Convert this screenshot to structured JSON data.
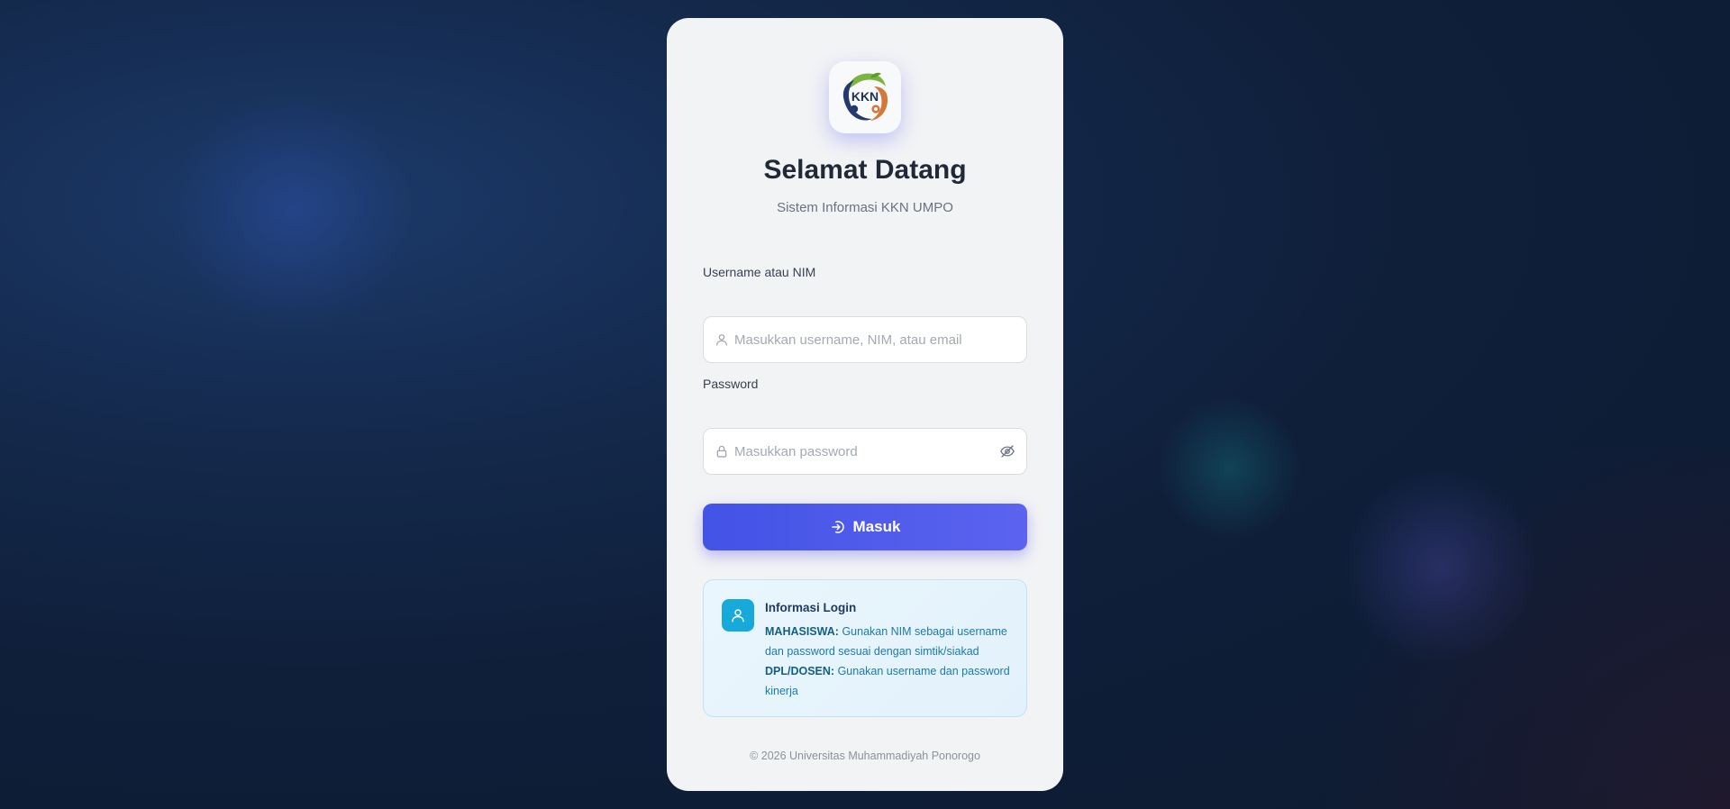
{
  "logo": {
    "text": "KKN",
    "icon": "kkn-logo-icon"
  },
  "header": {
    "title": "Selamat Datang",
    "subtitle": "Sistem Informasi KKN UMPO"
  },
  "form": {
    "username": {
      "label": "Username atau NIM",
      "placeholder": "Masukkan username, NIM, atau email",
      "value": "",
      "icon": "user-icon"
    },
    "password": {
      "label": "Password",
      "placeholder": "Masukkan password",
      "value": "",
      "icon": "lock-icon",
      "toggle_icon": "eye-off-icon"
    },
    "submit": {
      "label": "Masuk",
      "icon": "login-icon"
    }
  },
  "info": {
    "icon": "user-icon",
    "title": "Informasi Login",
    "mahasiswa_label": "MAHASISWA:",
    "mahasiswa_text": "Gunakan NIM sebagai username dan password sesuai dengan simtik/siakad",
    "dosen_label": "DPL/DOSEN:",
    "dosen_text": "Gunakan username dan password kinerja"
  },
  "footer": {
    "copyright": "© 2026 Universitas Muhammadiyah Ponorogo"
  },
  "colors": {
    "primary": "#4f46e5",
    "info_accent": "#17a9d9",
    "card_bg": "#f2f3f5",
    "page_bg": "#0f1f3a"
  }
}
